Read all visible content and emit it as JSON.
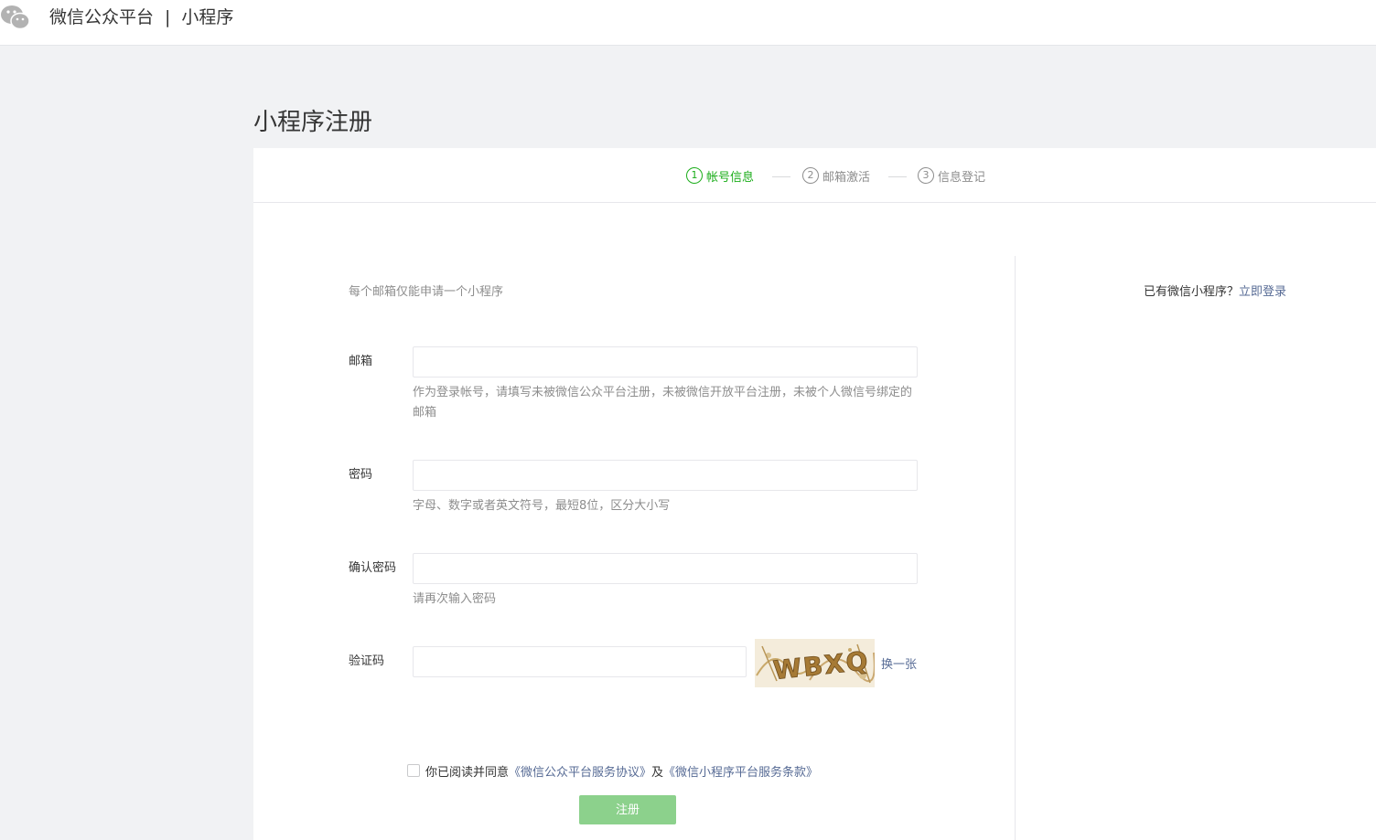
{
  "header": {
    "brand": "微信公众平台",
    "separator": "|",
    "product": "小程序"
  },
  "page": {
    "title": "小程序注册"
  },
  "steps": [
    {
      "num": "1",
      "label": "帐号信息",
      "active": true
    },
    {
      "num": "2",
      "label": "邮箱激活",
      "active": false
    },
    {
      "num": "3",
      "label": "信息登记",
      "active": false
    }
  ],
  "form": {
    "tip": "每个邮箱仅能申请一个小程序",
    "email": {
      "label": "邮箱",
      "value": "",
      "help": "作为登录帐号，请填写未被微信公众平台注册，未被微信开放平台注册，未被个人微信号绑定的邮箱"
    },
    "password": {
      "label": "密码",
      "value": "",
      "help": "字母、数字或者英文符号，最短8位，区分大小写"
    },
    "confirm": {
      "label": "确认密码",
      "value": "",
      "help": "请再次输入密码"
    },
    "captcha": {
      "label": "验证码",
      "value": "",
      "image_text": "WBXQ",
      "swap": "换一张"
    },
    "agreement": {
      "prefix": "你已阅读并同意",
      "link1": "《微信公众平台服务协议》",
      "and": "及",
      "link2": "《微信小程序平台服务条款》",
      "checked": false
    },
    "submit": "注册"
  },
  "side": {
    "question": "已有微信小程序？",
    "login_link": "立即登录"
  },
  "colors": {
    "accent_green": "#1aad19",
    "link_blue": "#576b95",
    "disabled_button": "#8cd18c"
  }
}
